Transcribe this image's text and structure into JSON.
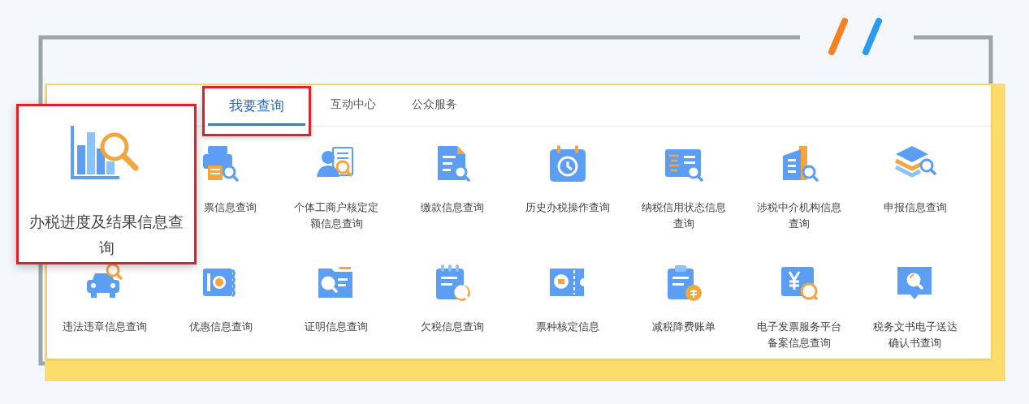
{
  "tabs": [
    {
      "label": "我要查询",
      "selected": true
    },
    {
      "label": "互动中心",
      "selected": false
    },
    {
      "label": "公众服务",
      "selected": false
    }
  ],
  "callout": {
    "label": "办税进度及结果信息查询"
  },
  "services": [
    {
      "label": "票信息查询"
    },
    {
      "label": "个体工商户核定定额信息查询"
    },
    {
      "label": "缴款信息查询"
    },
    {
      "label": "历史办税操作查询"
    },
    {
      "label": "纳税信用状态信息查询"
    },
    {
      "label": "涉税中介机构信息查询"
    },
    {
      "label": "申报信息查询"
    },
    {
      "label": "违法违章信息查询"
    },
    {
      "label": "优惠信息查询"
    },
    {
      "label": "证明信息查询"
    },
    {
      "label": "欠税信息查询"
    },
    {
      "label": "票种核定信息"
    },
    {
      "label": "减税降费账单"
    },
    {
      "label": "电子发票服务平台备案信息查询"
    },
    {
      "label": "税务文书电子送达确认书查询"
    }
  ]
}
